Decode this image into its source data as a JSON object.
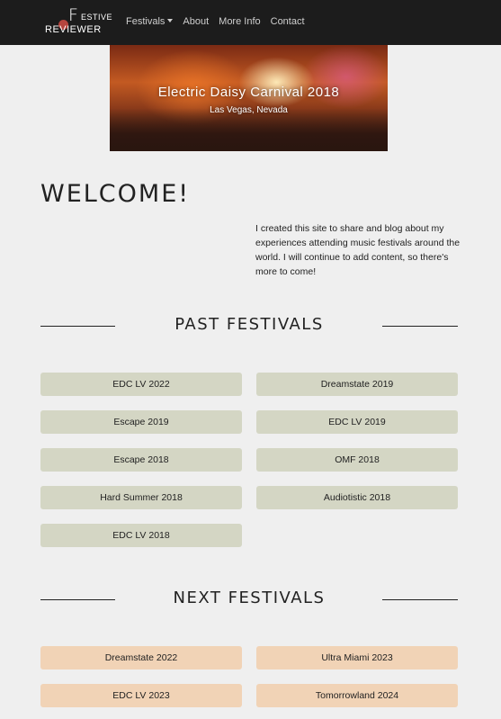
{
  "nav": {
    "brand_f": "F",
    "brand_estive": "ESTIVE",
    "brand_reviewer": "REVIEWER",
    "links": [
      "Festivals",
      "About",
      "More Info",
      "Contact"
    ]
  },
  "hero": {
    "title": "Electric Daisy Carnival 2018",
    "subtitle": "Las Vegas, Nevada"
  },
  "welcome": {
    "heading": "WELCOME!",
    "text": "I created this site to share and blog about my experiences attending music festivals around the world. I will continue to add content, so there's more to come!"
  },
  "past": {
    "heading": "PAST FESTIVALS",
    "items": [
      "EDC LV 2022",
      "Dreamstate 2019",
      "Escape 2019",
      "EDC LV 2019",
      "Escape 2018",
      "OMF 2018",
      "Hard Summer 2018",
      "Audiotistic 2018",
      "EDC LV 2018"
    ]
  },
  "next": {
    "heading": "NEXT FESTIVALS",
    "items": [
      "Dreamstate 2022",
      "Ultra Miami 2023",
      "EDC LV 2023",
      "Tomorrowland 2024"
    ]
  },
  "colors": {
    "navbar": "#1c1c1c",
    "background": "#efefef",
    "past_button": "#d4d6c4",
    "next_button": "#f1d3b6",
    "logo_accent": "#b5453e"
  }
}
